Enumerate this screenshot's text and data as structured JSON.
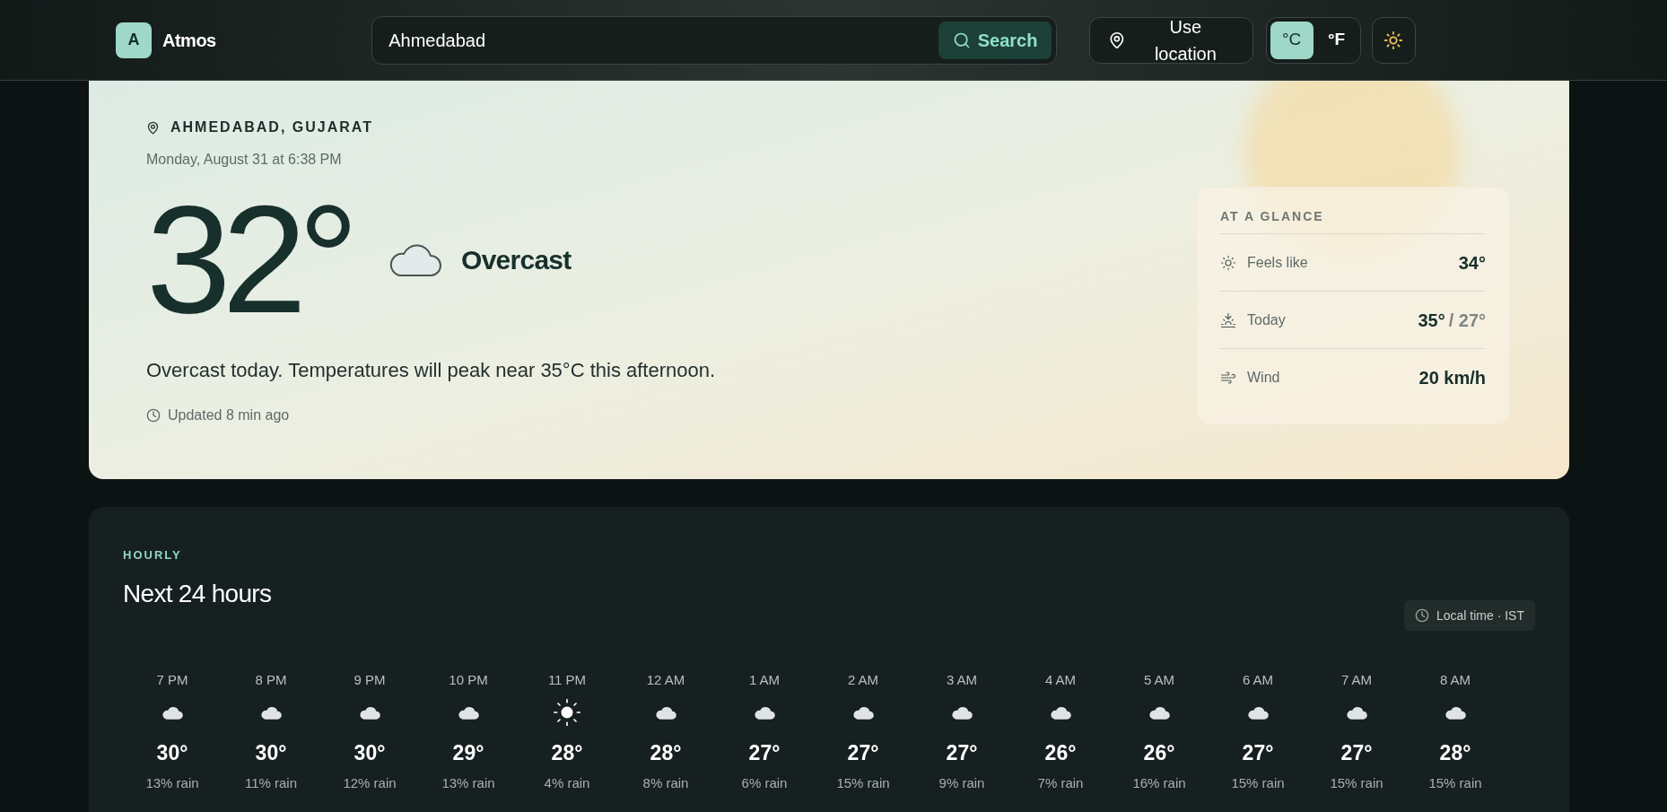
{
  "brand": {
    "letter": "A",
    "name": "Atmos"
  },
  "search": {
    "value": "Ahmedabad",
    "button": "Search"
  },
  "location_button": "Use location",
  "units": [
    {
      "label": "°C",
      "selected": true
    },
    {
      "label": "°F",
      "selected": false
    }
  ],
  "current": {
    "place": "AHMEDABAD, GUJARAT",
    "datetime": "Monday, August 31 at 6:38 PM",
    "temperature": "32°",
    "condition": "Overcast",
    "summary": "Overcast today. Temperatures will peak near 35°C this afternoon.",
    "updated": "Updated 8 min ago"
  },
  "glance": {
    "title": "AT A GLANCE",
    "rows": [
      {
        "kind": "feels",
        "label": "Feels like",
        "value": "34°"
      },
      {
        "kind": "range",
        "label": "Today",
        "value": "35°",
        "value_low": "/ 27°"
      },
      {
        "kind": "wind",
        "label": "Wind",
        "value": "20 km/h"
      }
    ]
  },
  "hourly": {
    "eyebrow": "HOURLY",
    "title": "Next 24 hours",
    "timezone": "Local time · IST",
    "hours": [
      {
        "time": "7 PM",
        "kind": "cloud",
        "temp": "30°",
        "rain": "13% rain"
      },
      {
        "time": "8 PM",
        "kind": "cloud",
        "temp": "30°",
        "rain": "11% rain"
      },
      {
        "time": "9 PM",
        "kind": "cloud",
        "temp": "30°",
        "rain": "12% rain"
      },
      {
        "time": "10 PM",
        "kind": "cloud",
        "temp": "29°",
        "rain": "13% rain"
      },
      {
        "time": "11 PM",
        "kind": "sun",
        "temp": "28°",
        "rain": "4% rain"
      },
      {
        "time": "12 AM",
        "kind": "cloud",
        "temp": "28°",
        "rain": "8% rain"
      },
      {
        "time": "1 AM",
        "kind": "cloud",
        "temp": "27°",
        "rain": "6% rain"
      },
      {
        "time": "2 AM",
        "kind": "cloud",
        "temp": "27°",
        "rain": "15% rain"
      },
      {
        "time": "3 AM",
        "kind": "cloud",
        "temp": "27°",
        "rain": "9% rain"
      },
      {
        "time": "4 AM",
        "kind": "cloud",
        "temp": "26°",
        "rain": "7% rain"
      },
      {
        "time": "5 AM",
        "kind": "cloud",
        "temp": "26°",
        "rain": "16% rain"
      },
      {
        "time": "6 AM",
        "kind": "cloud",
        "temp": "27°",
        "rain": "15% rain"
      },
      {
        "time": "7 AM",
        "kind": "cloud",
        "temp": "27°",
        "rain": "15% rain"
      },
      {
        "time": "8 AM",
        "kind": "cloud",
        "temp": "28°",
        "rain": "15% rain"
      }
    ]
  }
}
